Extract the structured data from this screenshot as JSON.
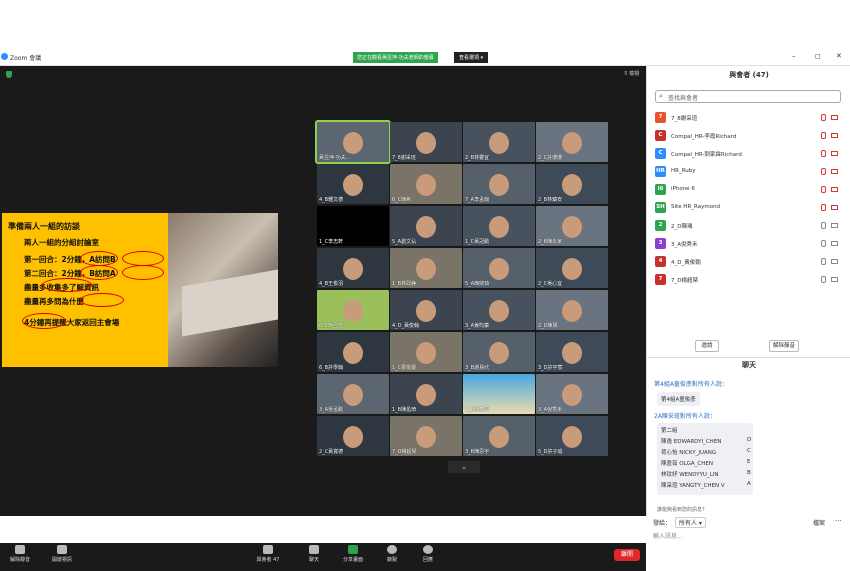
{
  "titlebar": {
    "title": "Zoom 會議",
    "minimize": "–",
    "maximize": "◻",
    "close": "✕"
  },
  "share_banner": "您正在觀看黃昱萍-功夫老師的螢幕",
  "view_options": "查看選項 ▾",
  "view_label": "⠿ 檢視",
  "slide": {
    "title": "準備兩人一組的訪談",
    "subtitle": "兩人一組的分組討論室",
    "round1": "第一回合：2分鐘，A訪問B",
    "round2": "第二回合：2分鐘，B訪問A",
    "line3": "盡量多收集多了解資訊",
    "line4": "盡量再多問為什麼",
    "line5": "4分鐘再提醒大家返回主會場"
  },
  "tiles": [
    "黃昱萍-功夫...",
    "7_8謝采瑄",
    "2_B林靈宜",
    "2_C許珊珊",
    "4_B鍾文德",
    "6_C陳希",
    "7_A李孟翰",
    "2_B林鎮安",
    "1_C李志軒",
    "5_A劉文弘",
    "1_C黃冠勳",
    "2_B陳永家",
    "4_B王俊羽",
    "1_B林政錚",
    "5_A簡婉茹",
    "2_C吳心宜",
    "6_C簡昱宏",
    "4_D_黃俊翰",
    "3_A姜昀蓁",
    "2_D陳瑀",
    "6_B許學翰",
    "1_C鄭俊慶",
    "3_B謝易欣",
    "3_D許宇宸",
    "3_A晏孟勳",
    "1_B陳盈琦",
    "1_B簡甚蓉",
    "3_A倪秀禾",
    "2_C黃寬德",
    "7_D楊超琹",
    "3_B陳思宇",
    "5_D許子瑜"
  ],
  "toolbar": {
    "unmute": "解除靜音",
    "video": "開啟視訊",
    "participants": "與會者",
    "participants_count": "47",
    "chat": "聊天",
    "share": "分享畫面",
    "record": "錄製",
    "reactions": "回應",
    "end": "離開"
  },
  "panel": {
    "title": "與會者 (47)",
    "search_placeholder": "查找與會者",
    "participants": [
      {
        "avatar": "7",
        "color": "#e8542a",
        "name": "7_8謝采瑄",
        "muted": true,
        "cam_off": true
      },
      {
        "avatar": "C",
        "color": "#c8302a",
        "name": "Compal_HR-李霞Richard",
        "muted": true,
        "cam_off": true
      },
      {
        "avatar": "C",
        "color": "#2d8cff",
        "name": "Compal_HR-劉家霖Richard",
        "muted": true,
        "cam_off": true
      },
      {
        "avatar": "HR",
        "color": "#2d8cff",
        "name": "HR_Ruby",
        "muted": true,
        "cam_off": true
      },
      {
        "avatar": "I6",
        "color": "#2ea44f",
        "name": "iPhone 6",
        "muted": true,
        "cam_off": true
      },
      {
        "avatar": "SH",
        "color": "#2ea44f",
        "name": "Site HR_Raymond",
        "muted": true,
        "cam_off": true
      },
      {
        "avatar": "2",
        "color": "#2ea44f",
        "name": "2_D陳瑀",
        "muted": false,
        "cam_off": false
      },
      {
        "avatar": "3",
        "color": "#8b3fd1",
        "name": "3_A倪秀禾",
        "muted": false,
        "cam_off": false
      },
      {
        "avatar": "4",
        "color": "#c8302a",
        "name": "4_D_黃俊翰",
        "muted": false,
        "cam_off": false
      },
      {
        "avatar": "7",
        "color": "#c8302a",
        "name": "7_D楊超琹",
        "muted": false,
        "cam_off": false
      }
    ],
    "invite": "邀請",
    "unmute_all": "解除靜音"
  },
  "chat": {
    "title": "聊天",
    "from1": "第4組A童俊彥對所有人說：",
    "msg1": "第4組A童俊彥",
    "from2": "2A陳采瑄對所有人說：",
    "msg2_title": "第二組",
    "rows": [
      {
        "name": "陳逸 EDWARDYI_CHEN",
        "letter": "D"
      },
      {
        "name": "荷心怡 NICKY_JUANG",
        "letter": "C"
      },
      {
        "name": "陳盈茹 OLGA_CHEN",
        "letter": "E"
      },
      {
        "name": "林玟妤 WENDYYU_LIN",
        "letter": "B"
      },
      {
        "name": "陳采瑄 YANGTY_CHEN V",
        "letter": "A"
      }
    ],
    "new_message": "誰能夠看到您的訊息？",
    "to_label": "發給：",
    "to_value": "所有人 ▾",
    "file": "檔案",
    "more": "···",
    "input_placeholder": "輸入訊息..."
  }
}
